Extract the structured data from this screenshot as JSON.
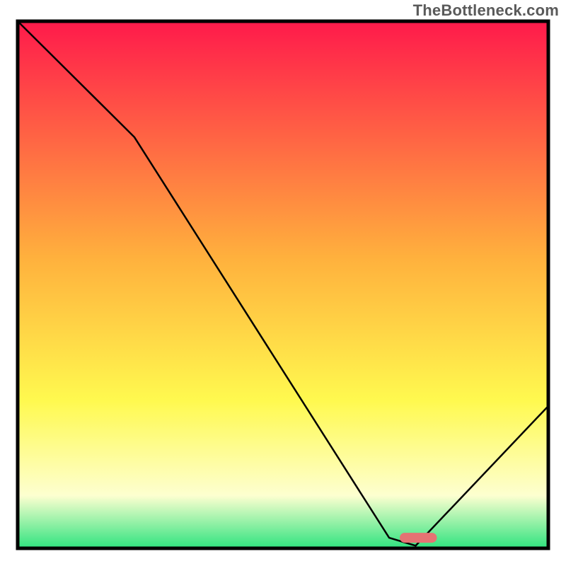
{
  "watermark": "TheBottleneck.com",
  "chart_data": {
    "type": "line",
    "title": "",
    "xlabel": "",
    "ylabel": "",
    "xlim": [
      0,
      100
    ],
    "ylim": [
      0,
      100
    ],
    "grid": false,
    "series": [
      {
        "name": "bottleneck-curve",
        "x": [
          0,
          22,
          70,
          75,
          100
        ],
        "values": [
          100,
          78,
          2,
          0.5,
          27
        ]
      }
    ],
    "marker": {
      "name": "optimal-range",
      "x_start": 72,
      "x_end": 79,
      "y": 2,
      "color": "#e57373"
    },
    "background_gradient": {
      "top": "#ff1a4b",
      "mid1": "#ffb13d",
      "mid2": "#fff94f",
      "mid3": "#fdffd0",
      "bottom": "#2fe37f"
    },
    "frame_color": "#000000",
    "line_color": "#000000",
    "line_width": 2.5
  }
}
